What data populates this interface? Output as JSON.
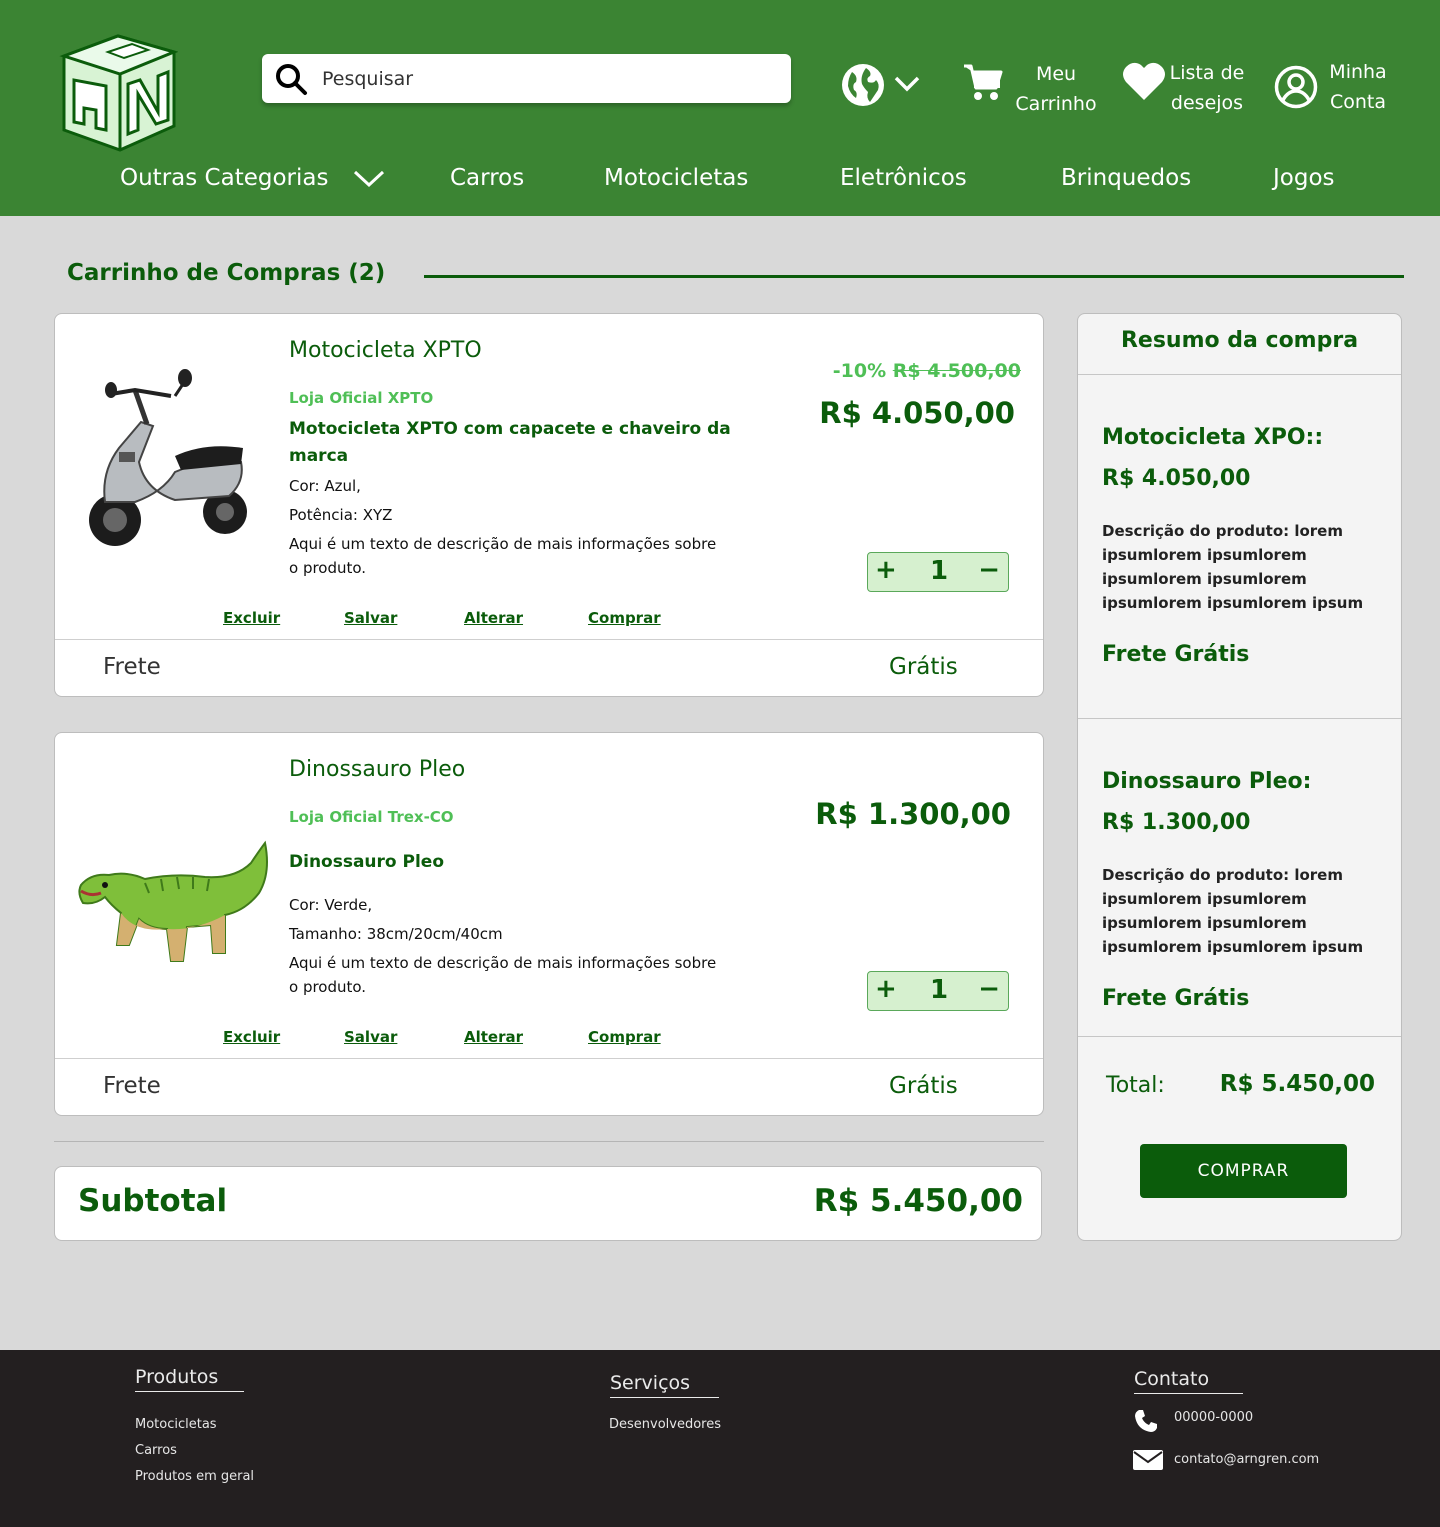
{
  "header": {
    "search_placeholder": "Pesquisar",
    "cart_line1": "Meu",
    "cart_line2": "Carrinho",
    "wishlist_line1": "Lista de",
    "wishlist_line2": "desejos",
    "account_line1": "Minha",
    "account_line2": "Conta",
    "nav": [
      "Outras Categorias",
      "Carros",
      "Motocicletas",
      "Eletrônicos",
      "Brinquedos",
      "Jogos"
    ],
    "icons": [
      "logo-cube-icon",
      "search-icon",
      "globe-icon",
      "chevron-down-icon",
      "cart-icon",
      "heart-icon",
      "user-icon"
    ]
  },
  "cart": {
    "title": "Carrinho de Compras (2)",
    "items": [
      {
        "name": "Motocicleta XPTO",
        "store": "Loja Oficial XPTO",
        "desc_title": "Motocicleta XPTO com capacete e chaveiro da marca",
        "attr1": "Cor: Azul,",
        "attr2": "Potência: XYZ",
        "more": "Aqui é um texto de descrição de mais informações sobre o produto.",
        "discount": "-10%",
        "old_price": "R$ 4.500,00",
        "price": "R$ 4.050,00",
        "quantity": "1",
        "qty_plus": "+",
        "qty_minus": "−",
        "actions": [
          "Excluir",
          "Salvar",
          "Alterar",
          "Comprar"
        ],
        "shipping_label": "Frete",
        "shipping_value": "Grátis"
      },
      {
        "name": "Dinossauro Pleo",
        "store": "Loja Oficial Trex-CO",
        "desc_title": "Dinossauro Pleo",
        "attr1": "Cor: Verde,",
        "attr2": "Tamanho: 38cm/20cm/40cm",
        "more": "Aqui é um texto de descrição de mais informações sobre o produto.",
        "price": "R$ 1.300,00",
        "quantity": "1",
        "qty_plus": "+",
        "qty_minus": "−",
        "actions": [
          "Excluir",
          "Salvar",
          "Alterar",
          "Comprar"
        ],
        "shipping_label": "Frete",
        "shipping_value": "Grátis"
      }
    ],
    "subtotal_label": "Subtotal",
    "subtotal_value": "R$ 5.450,00"
  },
  "summary": {
    "title": "Resumo da compra",
    "items": [
      {
        "name": "Motocicleta XPO::",
        "price": "R$ 4.050,00",
        "desc": "Descrição do produto: lorem ipsumlorem ipsumlorem ipsumlorem ipsumlorem ipsumlorem ipsumlorem ipsum",
        "shipping": "Frete Grátis"
      },
      {
        "name": "Dinossauro Pleo:",
        "price": "R$ 1.300,00",
        "desc": "Descrição do produto: lorem ipsumlorem ipsumlorem ipsumlorem ipsumlorem ipsumlorem ipsumlorem ipsum",
        "shipping": "Frete Grátis"
      }
    ],
    "total_label": "Total:",
    "total_value": "R$ 5.450,00",
    "buy_button": "COMPRAR"
  },
  "footer": {
    "products": {
      "title": "Produtos",
      "links": [
        "Motocicletas",
        "Carros",
        "Produtos em geral"
      ]
    },
    "services": {
      "title": "Serviços",
      "links": [
        "Desenvolvedores"
      ]
    },
    "contact": {
      "title": "Contato",
      "phone": "00000-0000",
      "email": "contato@arngren.com"
    }
  },
  "colors": {
    "header_green": "#3b8433",
    "dark_green": "#0b5c0b",
    "light_green": "#4fbf56",
    "footer_bg": "#231f20",
    "page_bg": "#d9d9d9"
  }
}
